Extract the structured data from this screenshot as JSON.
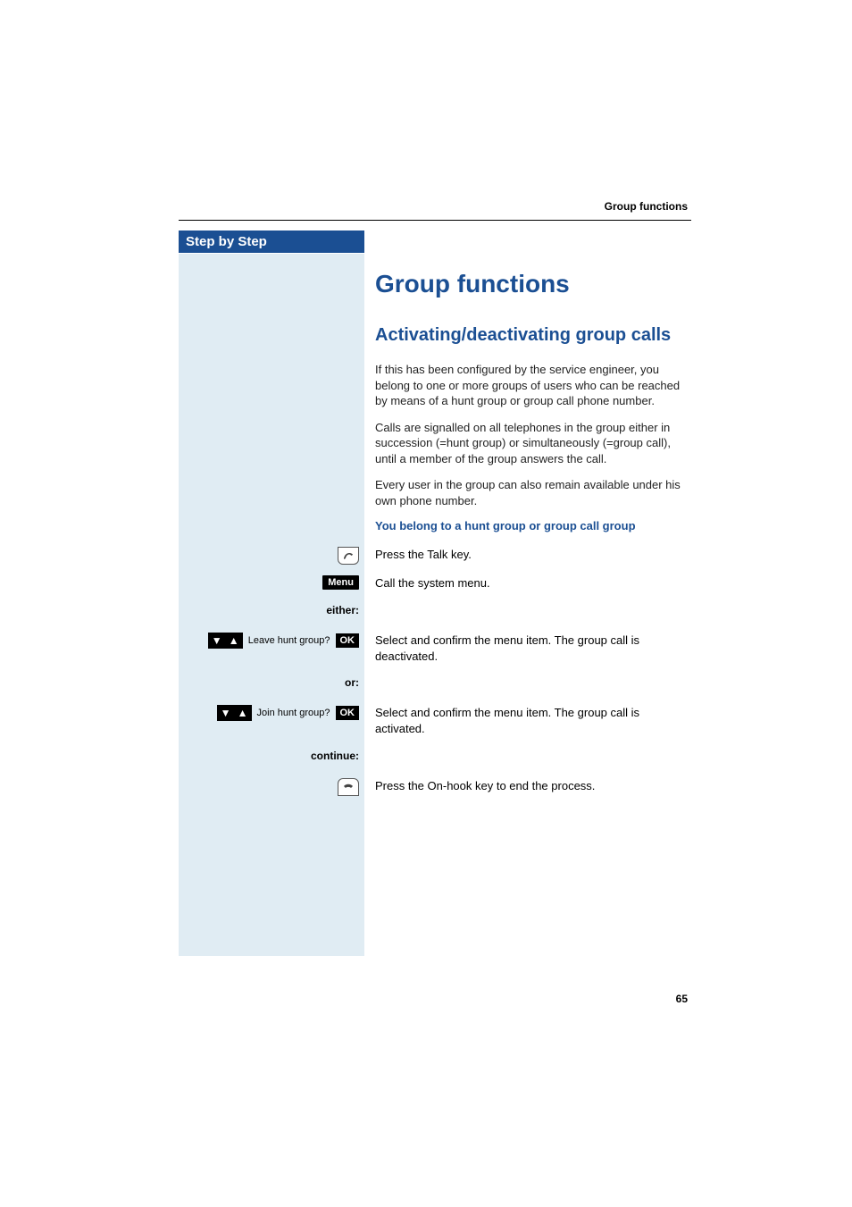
{
  "header": {
    "running_title": "Group functions"
  },
  "sidebar": {
    "title": "Step by Step"
  },
  "main": {
    "h1": "Group functions",
    "h2": "Activating/deactivating group calls",
    "paragraphs": [
      "If this has been configured by the service engineer, you belong to one or more groups of users who can be reached by means of a hunt group or group call phone number.",
      "Calls are signalled on all telephones in the group either in succession (=hunt group) or simultaneously (=group call), until a member of the group answers the call.",
      "Every user in the group can also remain available under his own phone number."
    ],
    "sub_head": "You belong to a hunt group or group call group"
  },
  "steps": {
    "talk_key": {
      "text": "Press the Talk key."
    },
    "menu": {
      "chip": "Menu",
      "text": "Call the system menu."
    },
    "either_label": "either:",
    "leave_group": {
      "display": "Leave hunt group?",
      "ok": "OK",
      "text": "Select and confirm the menu item. The group call is deactivated."
    },
    "or_label": "or:",
    "join_group": {
      "display": "Join hunt group?",
      "ok": "OK",
      "text": "Select and confirm the menu item. The group call is activated."
    },
    "continue_label": "continue:",
    "onhook": {
      "text": "Press the On-hook key to end the process."
    }
  },
  "page_number": "65"
}
